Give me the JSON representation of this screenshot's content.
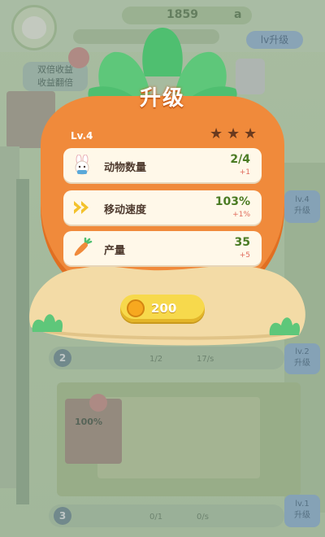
{
  "background": {
    "coins": "1859",
    "coin_unit": "a",
    "top_upgrade_btn": "lv升级",
    "left_btn": "双倍收益\n收益翻倍",
    "side_btn_1": "lv.4\n升级",
    "side_btn_2": "lv.2\n升级",
    "side_btn_3": "lv.1\n升级",
    "row2_num": "2",
    "row2_text": "1/2",
    "row2_rate": "17/s",
    "row3_num": "3",
    "row3_text": "0/1",
    "row3_rate": "0/s",
    "stall_pct": "100%"
  },
  "popup": {
    "title": "升级",
    "level": "Lv.4",
    "stars_filled": 0,
    "stars_total": 3,
    "stats": [
      {
        "icon": "rabbit-icon",
        "label": "动物数量",
        "value": "2/4",
        "delta": "+1"
      },
      {
        "icon": "speed-arrows-icon",
        "label": "移动速度",
        "value": "103%",
        "delta": "+1%"
      },
      {
        "icon": "carrot-icon",
        "label": "产量",
        "value": "35",
        "delta": "+5"
      }
    ],
    "cost": "200"
  },
  "colors": {
    "carrot": "#f08a3b",
    "leaf": "#5ec77a",
    "panel": "#fff8e9",
    "value_green": "#4a7b23",
    "delta_red": "#e06a5a",
    "button_yellow": "#f7d94c"
  }
}
